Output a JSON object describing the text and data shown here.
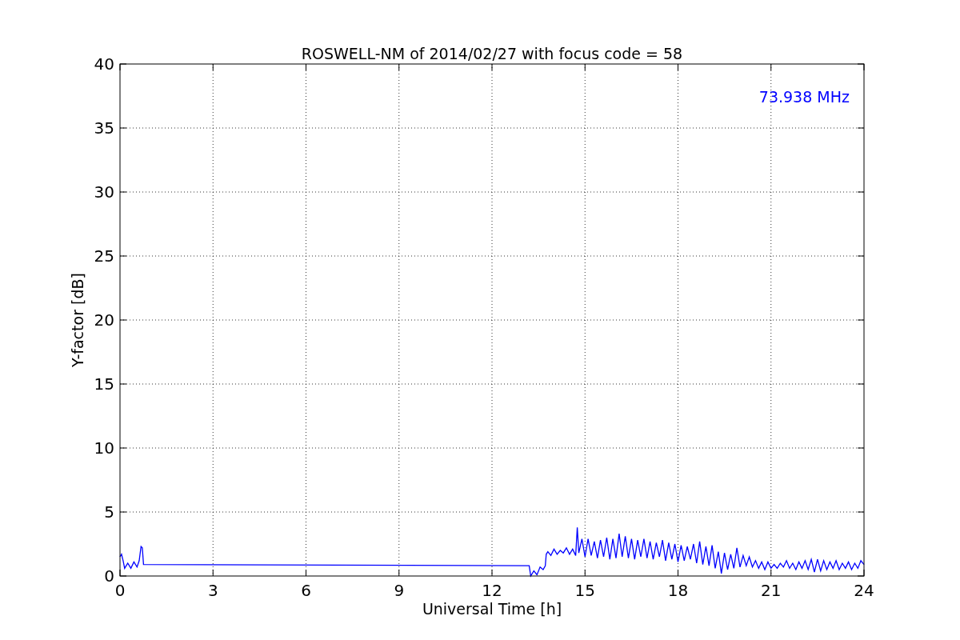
{
  "figure": {
    "chart_data": {
      "type": "line",
      "title": "ROSWELL-NM of 2014/02/27 with focus code = 58",
      "xlabel": "Universal Time [h]",
      "ylabel": "Y-factor [dB]",
      "x": [
        0,
        0.05,
        0.1,
        0.15,
        0.25,
        0.35,
        0.45,
        0.55,
        0.62,
        0.68,
        0.72,
        0.76,
        13.2,
        13.25,
        13.35,
        13.45,
        13.55,
        13.65,
        13.72,
        13.75,
        13.8,
        13.9,
        14.0,
        14.1,
        14.2,
        14.3,
        14.4,
        14.5,
        14.6,
        14.7,
        14.75,
        14.8,
        14.9,
        15.0,
        15.1,
        15.2,
        15.3,
        15.4,
        15.5,
        15.6,
        15.7,
        15.8,
        15.9,
        16.0,
        16.1,
        16.2,
        16.3,
        16.4,
        16.5,
        16.6,
        16.7,
        16.8,
        16.9,
        17.0,
        17.1,
        17.2,
        17.3,
        17.4,
        17.5,
        17.6,
        17.7,
        17.8,
        17.9,
        18.0,
        18.1,
        18.2,
        18.3,
        18.4,
        18.5,
        18.6,
        18.7,
        18.8,
        18.9,
        19.0,
        19.1,
        19.2,
        19.3,
        19.4,
        19.5,
        19.6,
        19.7,
        19.8,
        19.9,
        20.0,
        20.1,
        20.2,
        20.3,
        20.4,
        20.5,
        20.6,
        20.7,
        20.8,
        20.9,
        21.0,
        21.1,
        21.2,
        21.3,
        21.4,
        21.5,
        21.6,
        21.7,
        21.8,
        21.9,
        22.0,
        22.1,
        22.2,
        22.3,
        22.4,
        22.5,
        22.6,
        22.7,
        22.8,
        22.9,
        23.0,
        23.1,
        23.2,
        23.3,
        23.4,
        23.5,
        23.6,
        23.7,
        23.8,
        23.9,
        24.0
      ],
      "series": [
        {
          "color": "#0000ff",
          "values": [
            1.5,
            1.7,
            1.2,
            0.6,
            1.0,
            0.6,
            1.1,
            0.7,
            1.2,
            2.3,
            2.2,
            0.9,
            0.8,
            0.0,
            0.4,
            0.1,
            0.7,
            0.5,
            0.8,
            1.7,
            1.9,
            1.6,
            2.1,
            1.7,
            2.0,
            1.8,
            2.2,
            1.7,
            2.1,
            1.6,
            3.8,
            1.8,
            2.9,
            1.5,
            2.9,
            1.6,
            2.7,
            1.4,
            2.8,
            1.5,
            3.0,
            1.3,
            2.9,
            1.4,
            3.3,
            1.5,
            3.1,
            1.4,
            2.9,
            1.3,
            2.8,
            1.5,
            2.9,
            1.4,
            2.7,
            1.3,
            2.6,
            1.5,
            2.8,
            1.2,
            2.6,
            1.3,
            2.5,
            1.1,
            2.4,
            1.2,
            2.3,
            1.3,
            2.5,
            1.0,
            2.7,
            0.9,
            2.3,
            0.8,
            2.4,
            0.6,
            1.9,
            0.2,
            1.8,
            0.5,
            1.7,
            0.6,
            2.2,
            0.7,
            1.6,
            0.8,
            1.5,
            0.7,
            1.2,
            0.6,
            1.1,
            0.5,
            1.1,
            0.6,
            0.9,
            0.6,
            1.0,
            0.7,
            1.2,
            0.6,
            1.0,
            0.5,
            1.1,
            0.6,
            1.2,
            0.5,
            1.3,
            0.3,
            1.3,
            0.4,
            1.2,
            0.5,
            1.1,
            0.6,
            1.2,
            0.5,
            1.0,
            0.6,
            1.1,
            0.5,
            1.0,
            0.6,
            1.2,
            0.9
          ]
        }
      ],
      "xlim": [
        0,
        24
      ],
      "ylim": [
        0,
        40
      ],
      "xticks": [
        0,
        3,
        6,
        9,
        12,
        15,
        18,
        21,
        24
      ],
      "yticks": [
        0,
        5,
        10,
        15,
        20,
        25,
        30,
        35,
        40
      ],
      "grid": true,
      "annotations": [
        "73.938 MHz"
      ]
    }
  }
}
